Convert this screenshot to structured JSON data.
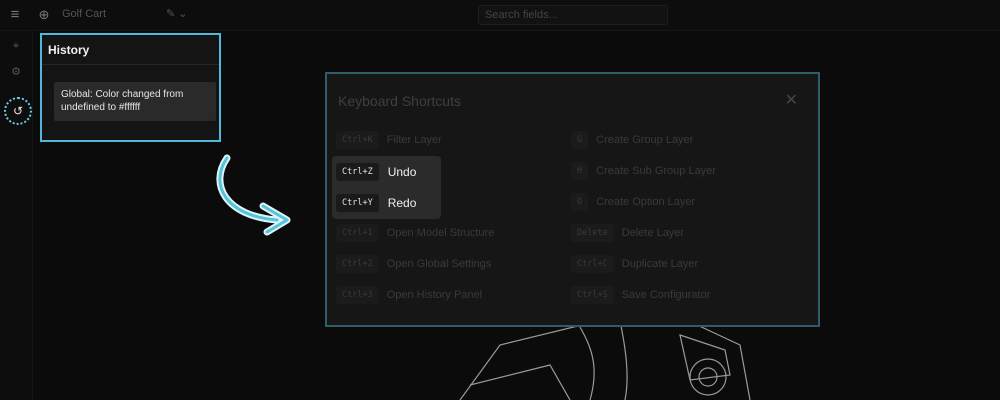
{
  "topbar": {
    "project_name": "Golf Cart",
    "search_placeholder": "Search fields..."
  },
  "history": {
    "title": "History",
    "entries": [
      "Global: Color changed from undefined to #ffffff"
    ]
  },
  "shortcuts": {
    "title": "Keyboard Shortcuts",
    "left": [
      {
        "key": "Ctrl+K",
        "label": "Filter Layer"
      },
      {
        "key": "Ctrl+Z",
        "label": "Undo"
      },
      {
        "key": "Ctrl+Y",
        "label": "Redo"
      },
      {
        "key": "Ctrl+1",
        "label": "Open Model Structure"
      },
      {
        "key": "Ctrl+2",
        "label": "Open Global Settings"
      },
      {
        "key": "Ctrl+3",
        "label": "Open History Panel"
      }
    ],
    "right": [
      {
        "key": "G",
        "label": "Create Group Layer"
      },
      {
        "key": "H",
        "label": "Create Sub Group Layer"
      },
      {
        "key": "O",
        "label": "Create Option Layer"
      },
      {
        "key": "Delete",
        "label": "Delete Layer"
      },
      {
        "key": "Ctrl+C",
        "label": "Duplicate Layer"
      },
      {
        "key": "Ctrl+S",
        "label": "Save Configurator"
      }
    ]
  },
  "colors": {
    "accent": "#50b9d8",
    "background": "#0b0b0b",
    "panel": "#141414"
  }
}
